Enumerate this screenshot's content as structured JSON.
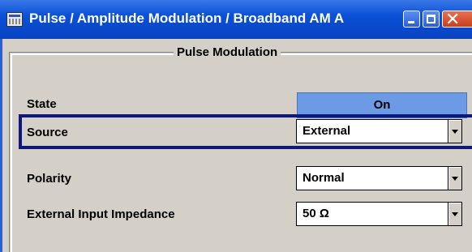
{
  "window": {
    "title": "Pulse  / Amplitude Modulation / Broadband AM A",
    "controls": [
      "minimize-icon",
      "maximize-icon",
      "close-icon"
    ],
    "colors": {
      "titlebar": "#0a50d8",
      "state_on": "#6c9ae4",
      "focus_frame": "#0c1880"
    }
  },
  "group": {
    "title": "Pulse Modulation"
  },
  "state": {
    "label": "State",
    "value": "On"
  },
  "source": {
    "label": "Source",
    "value": "External"
  },
  "polarity": {
    "label": "Polarity",
    "value": "Normal"
  },
  "impedance": {
    "label": "External Input Impedance",
    "value": "50 Ω"
  }
}
